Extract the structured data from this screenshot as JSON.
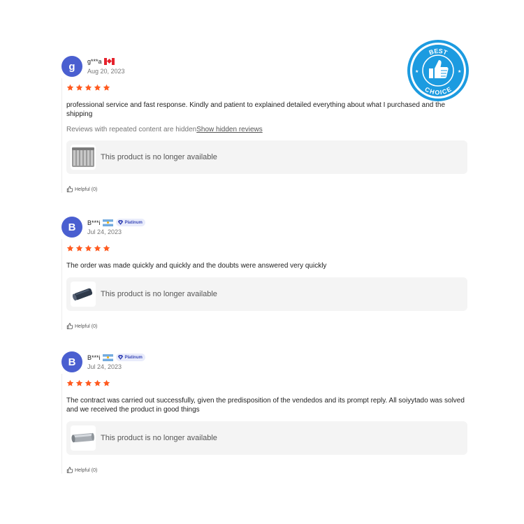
{
  "badge": {
    "line1": "BEST",
    "line2": "CHOICE",
    "color": "#1c9be0"
  },
  "colors": {
    "avatar": "#4a5fd0",
    "star": "#ff5a1f",
    "product_bg": "#f4f4f4"
  },
  "reviews": [
    {
      "avatar_letter": "g",
      "username": "g***a",
      "flag": "flag-canada-icon",
      "badge": "",
      "date": "Aug 20, 2023",
      "rating": 5,
      "text": "professional service and fast response. Kindly and patient to explained detailed everything about what I purchased and the shipping",
      "hidden_note": "Reviews with repeated content are hidden",
      "hidden_link": "Show hidden reviews",
      "product_status": "This product is no longer available",
      "helpful": "Helpful (0)"
    },
    {
      "avatar_letter": "B",
      "username": "B***i",
      "flag": "flag-argentina-icon",
      "badge": "Platinum",
      "date": "Jul 24, 2023",
      "rating": 5,
      "text": "The order was made quickly and quickly and the doubts were answered very quickly",
      "product_status": "This product is no longer available",
      "helpful": "Helpful (0)"
    },
    {
      "avatar_letter": "B",
      "username": "B***i",
      "flag": "flag-argentina-icon",
      "badge": "Platinum",
      "date": "Jul 24, 2023",
      "rating": 5,
      "text": "The contract was carried out successfully, given the predisposition of the vendedos and its prompt reply. All soiyytado was solved and we received the product in good things",
      "product_status": "This product is no longer available",
      "helpful": "Helpful (0)"
    }
  ]
}
